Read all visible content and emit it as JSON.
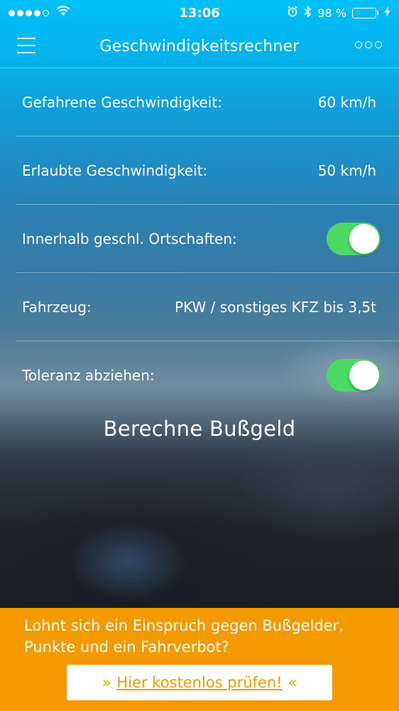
{
  "status_bar": {
    "time": "13:06",
    "battery": "98 %",
    "battery_level": 0.98,
    "signal_filled": 4,
    "signal_total": 5,
    "icons": [
      "wifi-icon",
      "alarm-icon",
      "bluetooth-icon",
      "charging-bolt-icon"
    ]
  },
  "nav": {
    "title": "Geschwindigkeitsrechner",
    "menu_icon": "hamburger-icon",
    "more_icon": "more-circles-icon"
  },
  "rows": [
    {
      "label": "Gefahrene Geschwindigkeit:",
      "value": "60 km/h"
    },
    {
      "label": "Erlaubte Geschwindigkeit:",
      "value": "50 km/h"
    },
    {
      "label": "Innerhalb geschl. Ortschaften:",
      "toggle_on": true
    },
    {
      "label": "Fahrzeug:",
      "value": "PKW / sonstiges KFZ bis 3,5t"
    },
    {
      "label": "Toleranz abziehen:",
      "toggle_on": true
    }
  ],
  "calculate_label": "Berechne Bußgeld",
  "banner": {
    "text": "Lohnt sich ein Einspruch gegen Bußgelder, Punkte und ein Fahrverbot?",
    "button_prefix": "»",
    "button_link": "Hier kostenlos prüfen!",
    "button_suffix": "«"
  },
  "colors": {
    "accent_blue": "#00c0f8",
    "toggle_green": "#4cd964",
    "banner_orange": "#f29a00",
    "text": "#ffffff"
  }
}
